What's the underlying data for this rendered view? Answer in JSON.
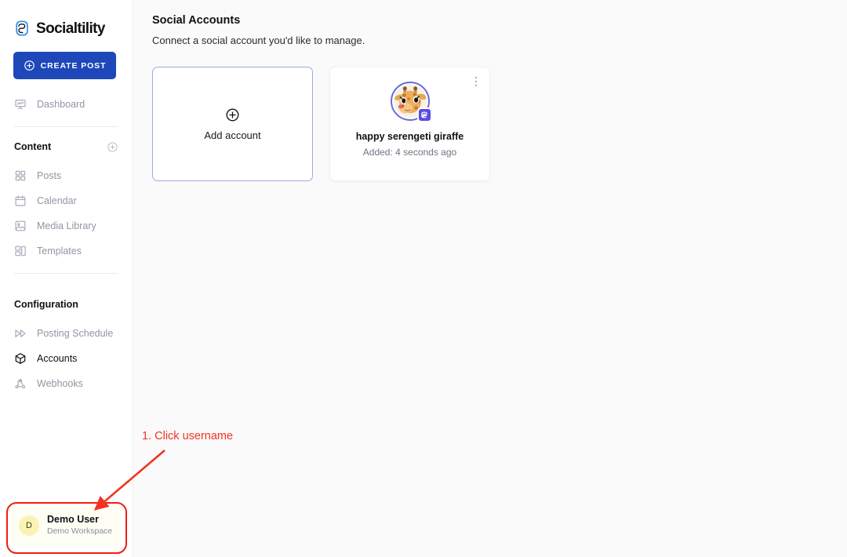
{
  "brand": {
    "name": "Socialtility",
    "logo_icon": "socialtility-logo-icon",
    "accent_color": "#1e47ba",
    "logo_mark_color": "#2a8bf2"
  },
  "sidebar": {
    "create_post": {
      "label": "CREATE POST",
      "icon": "plus-circle-icon"
    },
    "primary_items": [
      {
        "label": "Dashboard",
        "icon": "dashboard-icon",
        "active": false
      }
    ],
    "sections": [
      {
        "title": "Content",
        "add_icon": "plus-circle-icon",
        "items": [
          {
            "label": "Posts",
            "icon": "grid-icon",
            "active": false
          },
          {
            "label": "Calendar",
            "icon": "calendar-icon",
            "active": false
          },
          {
            "label": "Media Library",
            "icon": "image-icon",
            "active": false
          },
          {
            "label": "Templates",
            "icon": "layout-template-icon",
            "active": false
          }
        ]
      },
      {
        "title": "Configuration",
        "items": [
          {
            "label": "Posting Schedule",
            "icon": "fast-forward-icon",
            "active": false
          },
          {
            "label": "Accounts",
            "icon": "box-icon",
            "active": true
          },
          {
            "label": "Webhooks",
            "icon": "webhook-icon",
            "active": false
          }
        ]
      }
    ],
    "user": {
      "avatar_initial": "D",
      "name": "Demo User",
      "workspace": "Demo Workspace",
      "avatar_color": "#fbf3b4"
    }
  },
  "main": {
    "title": "Social Accounts",
    "subtitle": "Connect a social account you'd like to manage.",
    "add_card": {
      "label": "Add account",
      "icon": "plus-circle-icon"
    },
    "accounts": [
      {
        "name": "happy serengeti giraffe",
        "added_label": "Added: 4 seconds ago",
        "platform": "mastodon",
        "platform_badge_color": "#5b4be0",
        "avatar_ring_color": "#6b6bdd",
        "avatar_alt": "giraffe-avatar",
        "menu_icon": "kebab-menu-icon"
      }
    ]
  },
  "annotation": {
    "color": "#f4321f",
    "step_text": "1. Click username",
    "target": "user-card"
  }
}
